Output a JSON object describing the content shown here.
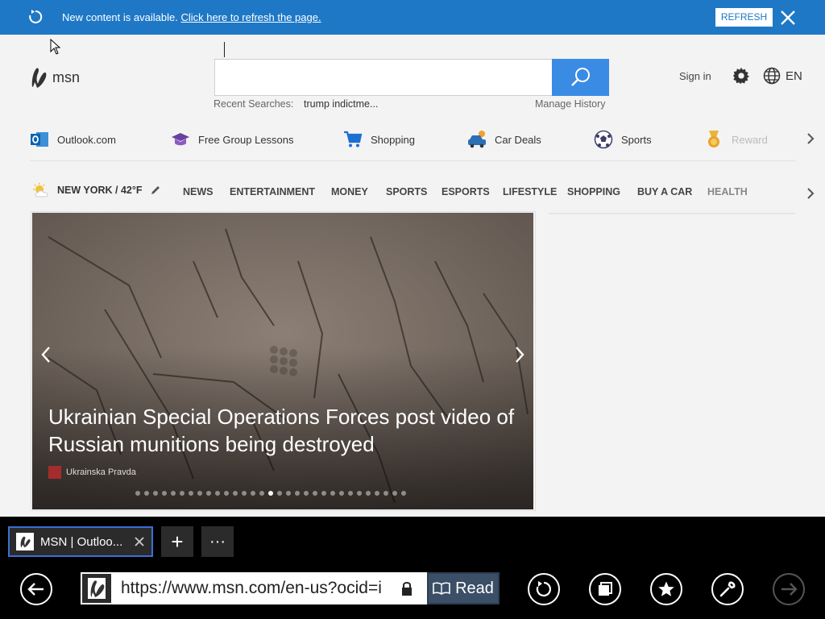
{
  "notification": {
    "message": "New content is available.",
    "link": "Click here to refresh the page.",
    "button": "REFRESH"
  },
  "header": {
    "logo": "msn",
    "recent_label": "Recent Searches:",
    "recent_term": "trump indictme...",
    "manage_history": "Manage History",
    "sign_in": "Sign in",
    "language": "EN"
  },
  "quick_links": [
    {
      "label": "Outlook.com",
      "icon": "outlook-icon"
    },
    {
      "label": "Free Group Lessons",
      "icon": "graduation-cap-icon"
    },
    {
      "label": "Shopping",
      "icon": "cart-icon"
    },
    {
      "label": "Car Deals",
      "icon": "car-icon"
    },
    {
      "label": "Sports",
      "icon": "soccer-ball-icon"
    },
    {
      "label": "Reward",
      "icon": "medal-icon"
    }
  ],
  "nav": {
    "weather": "NEW YORK / 42°F",
    "links": [
      "NEWS",
      "ENTERTAINMENT",
      "MONEY",
      "SPORTS",
      "ESPORTS",
      "LIFESTYLE",
      "SHOPPING",
      "BUY A CAR",
      "HEALTH"
    ]
  },
  "hero": {
    "headline": "Ukrainian Special Operations Forces post video of Russian munitions being destroyed",
    "source": "Ukrainska Pravda",
    "slide_count": 31,
    "active_slide": 15
  },
  "browser": {
    "tab_title": "MSN | Outloo...",
    "new_tab": "+",
    "more": "···",
    "url": "https://www.msn.com/en-us?ocid=i",
    "read": "Read"
  },
  "colors": {
    "notification_bg": "#1e78c6",
    "search_button": "#3a8be4",
    "chrome_bg": "#000000",
    "tab_border": "#3b6fd4"
  }
}
